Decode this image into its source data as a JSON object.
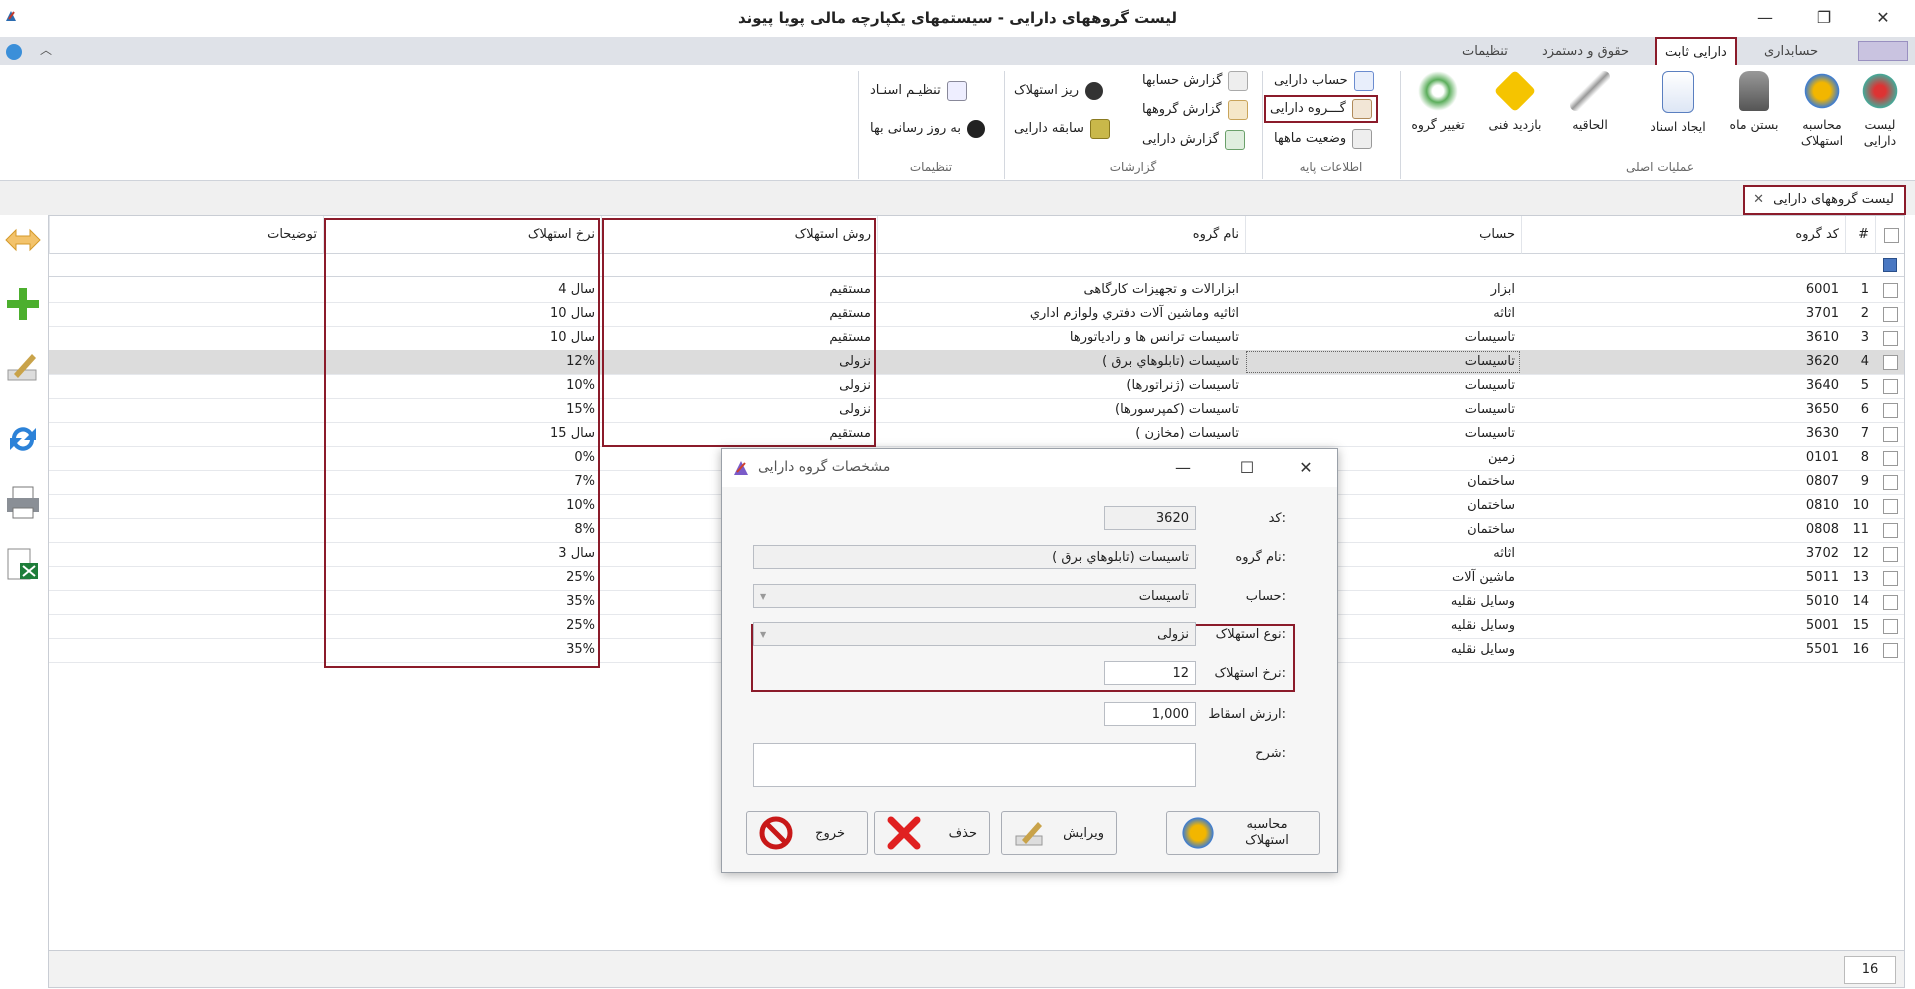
{
  "window": {
    "title": "لیست گروههای دارایی - سیستمهای یکپارچه مالی پویا پیوند",
    "minimize": "—",
    "restore": "❐",
    "close": "✕"
  },
  "ribbon_tabs": [
    {
      "label": "حسابداری"
    },
    {
      "label": "دارایی ثابت"
    },
    {
      "label": "حقوق و دستمزد"
    },
    {
      "label": "تنظیمات"
    }
  ],
  "ribbon": {
    "main_ops": {
      "label": "عملیات اصلی",
      "buttons": [
        {
          "label": "لیست دارایی"
        },
        {
          "label": "محاسبه استهلاک"
        },
        {
          "label": "بستن ماه"
        },
        {
          "label": "ایجاد اسناد"
        },
        {
          "label": "الحاقیه"
        },
        {
          "label": "بازدید فنی"
        },
        {
          "label": "تغییر گروه"
        }
      ]
    },
    "base_info": {
      "label": "اطلاعات پایه",
      "items": [
        {
          "label": "حساب دارایی"
        },
        {
          "label": "گـــروه دارایی"
        },
        {
          "label": "وضعیت ماهها"
        }
      ]
    },
    "reports": {
      "label": "گزارشات",
      "items": [
        {
          "label": "گزارش حسابها"
        },
        {
          "label": "گزارش گروهها"
        },
        {
          "label": "گزارش دارایی"
        },
        {
          "label": "ریز استهلاک"
        },
        {
          "label": "سابقه دارایی"
        }
      ]
    },
    "settings": {
      "label": "تنظیمات",
      "items": [
        {
          "label": "تنظیـم اسنـاد"
        },
        {
          "label": "به روز رسانی بها"
        }
      ]
    }
  },
  "doc_tab": {
    "label": "لیست گروههای دارایی",
    "close": "✕"
  },
  "grid": {
    "headers": {
      "num": "#",
      "code": "کد گروه",
      "account": "حساب",
      "group_name": "نام گروه",
      "method": "روش استهلاک",
      "rate": "نرخ استهلاک",
      "notes": "توضیحات"
    },
    "rows": [
      {
        "num": "1",
        "code": "6001",
        "account": "ابزار",
        "name": "ابزارالات و تجهیزات کارگاهی",
        "method": "مستقیم",
        "rate": "4 سال"
      },
      {
        "num": "2",
        "code": "3701",
        "account": "اثاثه",
        "name": "اثاثیه وماشین آلات دفتري ولوازم اداري",
        "method": "مستقیم",
        "rate": "10 سال"
      },
      {
        "num": "3",
        "code": "3610",
        "account": "تاسیسات",
        "name": "تاسیسات ترانس ها و رادیاتورها",
        "method": "مستقیم",
        "rate": "10 سال"
      },
      {
        "num": "4",
        "code": "3620",
        "account": "تاسیسات",
        "name": "تاسیسات (تابلوهاي برق )",
        "method": "نزولی",
        "rate": "12%"
      },
      {
        "num": "5",
        "code": "3640",
        "account": "تاسیسات",
        "name": "تاسیسات (ژنراتورها)",
        "method": "نزولی",
        "rate": "10%"
      },
      {
        "num": "6",
        "code": "3650",
        "account": "تاسیسات",
        "name": "تاسیسات (کمپرسورها)",
        "method": "نزولی",
        "rate": "15%"
      },
      {
        "num": "7",
        "code": "3630",
        "account": "تاسیسات",
        "name": "تاسیسات (مخازن )",
        "method": "مستقیم",
        "rate": "15 سال"
      },
      {
        "num": "8",
        "code": "0101",
        "account": "زمین",
        "name": "",
        "method": "",
        "rate": "0%"
      },
      {
        "num": "9",
        "code": "0807",
        "account": "ساختمان",
        "name": "",
        "method": "",
        "rate": "7%"
      },
      {
        "num": "10",
        "code": "0810",
        "account": "ساختمان",
        "name": "",
        "method": "",
        "rate": "10%"
      },
      {
        "num": "11",
        "code": "0808",
        "account": "ساختمان",
        "name": "",
        "method": "",
        "rate": "8%"
      },
      {
        "num": "12",
        "code": "3702",
        "account": "اثاثه",
        "name": "",
        "method": "",
        "rate": "3 سال"
      },
      {
        "num": "13",
        "code": "5011",
        "account": "ماشین آلات",
        "name": "",
        "method": "",
        "rate": "25%"
      },
      {
        "num": "14",
        "code": "5010",
        "account": "وسایل نقلیه",
        "name": "",
        "method": "",
        "rate": "35%"
      },
      {
        "num": "15",
        "code": "5001",
        "account": "وسایل نقلیه",
        "name": "",
        "method": "",
        "rate": "25%"
      },
      {
        "num": "16",
        "code": "5501",
        "account": "وسایل نقلیه",
        "name": "",
        "method": "",
        "rate": "35%"
      }
    ],
    "selected_row": "4",
    "row_count": "16"
  },
  "dialog": {
    "title": "مشخصات گروه دارایی",
    "fields": {
      "code_label": "کد:",
      "code_value": "3620",
      "name_label": "نام گروه:",
      "name_value": "تاسیسات (تابلوهاي برق )",
      "account_label": "حساب:",
      "account_value": "تاسیسات",
      "dep_type_label": "نوع استهلاک:",
      "dep_type_value": "نزولی",
      "dep_rate_label": "نرخ استهلاک:",
      "dep_rate_value": "12",
      "salvage_label": "ارزش اسقاط:",
      "salvage_value": "1,000",
      "desc_label": "شرح:",
      "desc_value": ""
    },
    "buttons": {
      "calc": "محاسبه استهلاک",
      "edit": "ویرایش",
      "delete": "حذف",
      "exit": "خروج"
    }
  },
  "colors": {
    "highlight": "#8b1b2a",
    "selected_row": "#dcdcdc"
  }
}
